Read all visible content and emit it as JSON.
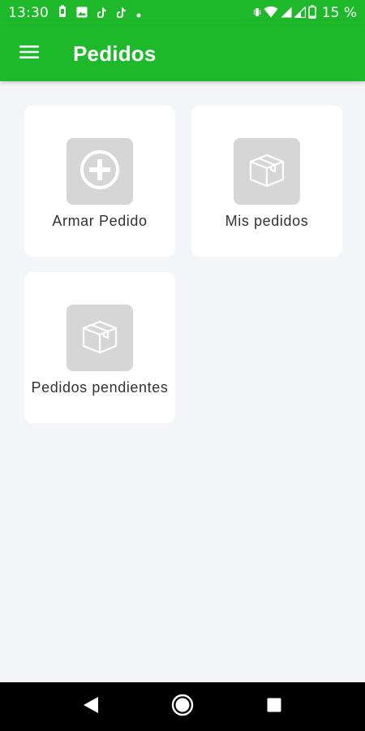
{
  "status_bar": {
    "time": "13:30",
    "battery": "15 %",
    "left_icons": [
      "battery-saver-icon",
      "image-icon",
      "tiktok-icon",
      "tiktok-icon",
      "dot-icon"
    ],
    "right_icons": [
      "vibrate-icon",
      "wifi-icon",
      "signal-icon",
      "signal-icon",
      "battery-icon"
    ]
  },
  "app_bar": {
    "title": "Pedidos",
    "menu_icon": "menu-icon",
    "color": "#1db92b"
  },
  "cards": [
    {
      "label": "Armar Pedido",
      "icon": "add-circle-icon"
    },
    {
      "label": "Mis pedidos",
      "icon": "box-icon"
    },
    {
      "label": "Pedidos pendientes",
      "icon": "box-icon"
    }
  ],
  "nav_bar": {
    "buttons": [
      "back-icon",
      "home-icon",
      "recents-icon"
    ]
  }
}
